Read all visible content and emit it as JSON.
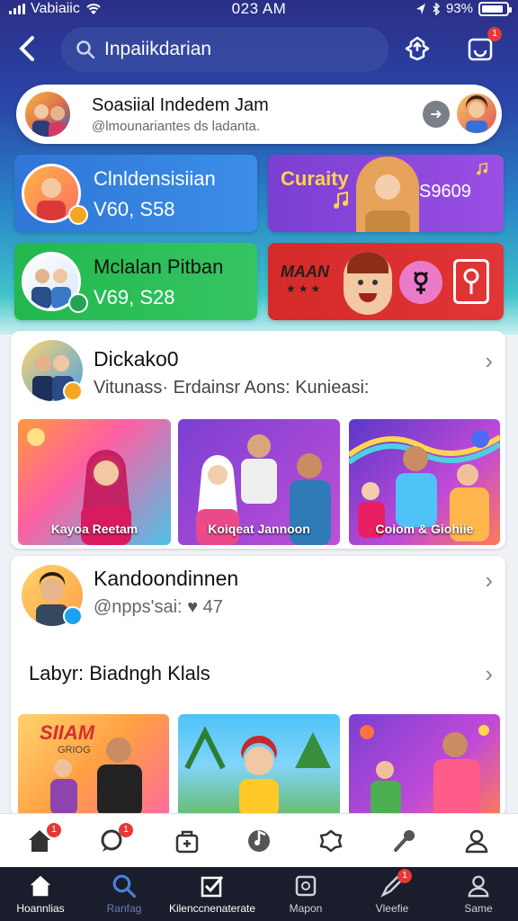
{
  "status_bar": {
    "carrier": "Vabiaiic",
    "time": "023 AM",
    "battery": "93%"
  },
  "header": {
    "search_value": "Inpaiikdarian",
    "notification_count": "1"
  },
  "profile_pill": {
    "title": "Soasiial Indedem Jam",
    "subtitle": "@lmounariantes ds ladanta."
  },
  "tiles": {
    "blue": {
      "title": "Clnldensisiian",
      "value": "V60, S58"
    },
    "purple": {
      "title": "Curaity",
      "value": "S9609"
    },
    "green": {
      "title": "Mclalan Pitban",
      "value": "V69, S28"
    },
    "red": {
      "title": "MAAN"
    }
  },
  "card1": {
    "title": "Dickako0",
    "subtitle": "Vitunass· Erdainsr Aons: Kunieasi:",
    "thumbs": [
      {
        "label": "Kayoa Reetam"
      },
      {
        "label": "Koiqeat Jannoon"
      },
      {
        "label": "Coiom & Giohiie"
      }
    ]
  },
  "card2": {
    "title": "Kandoondinnen",
    "handle": "@npps'sai:",
    "likes": "47",
    "section_title": "Labyr: Biadngh Klals",
    "thumbs": [
      {
        "label": ""
      },
      {
        "label": ""
      },
      {
        "label": ""
      }
    ],
    "thumb1_text": "SIIAM",
    "thumb1_subtext": "GRIOG"
  },
  "tab_bar": {
    "tabs": [
      {
        "label": "Hoannlias",
        "icon": "home-icon"
      },
      {
        "label": "Ranfag",
        "icon": "search-icon"
      },
      {
        "label": "Kilenccnenaterate",
        "icon": "checkbox-icon"
      },
      {
        "label": "Mapon",
        "icon": "map-icon"
      },
      {
        "label": "Vleefie",
        "icon": "edit-icon",
        "badge": "1"
      },
      {
        "label": "Same",
        "icon": "profile-icon"
      }
    ]
  },
  "action_bar": {
    "home_badge": "1",
    "chat_badge": "1"
  },
  "colors": {
    "accent_blue": "#2f76d6",
    "accent_purple": "#7b3fd2",
    "accent_green": "#22b84d",
    "accent_red": "#d42a2a",
    "tab_bar_bg": "#1a1d2b"
  }
}
